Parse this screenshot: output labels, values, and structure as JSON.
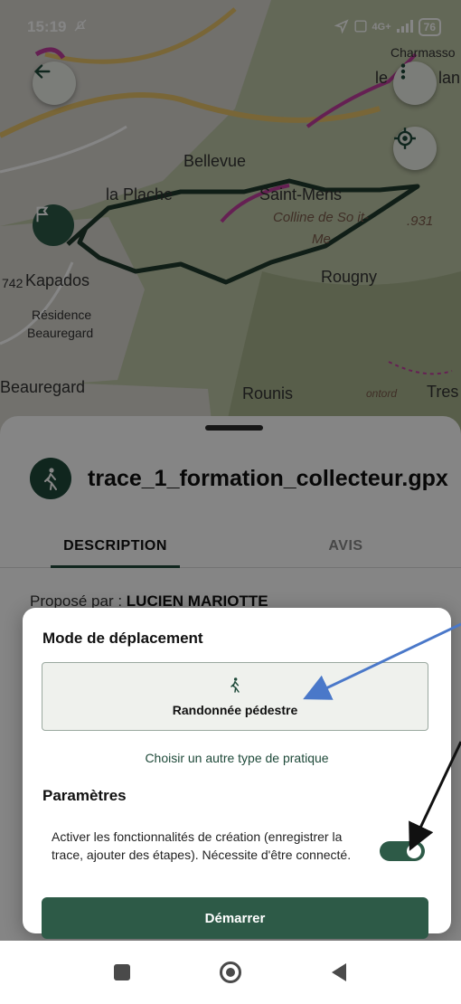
{
  "status_bar": {
    "time": "15:19",
    "network": "4G+",
    "battery": "76"
  },
  "map": {
    "labels": [
      "Charmasso",
      "le",
      "lan",
      "Bellevue",
      "la Plache",
      "Saint-Mens",
      "Colline de So it-",
      "Me",
      ".931",
      "742",
      "Kapados",
      "Rougny",
      "Résidence",
      "Beauregard",
      "Beauregard",
      "Rounis",
      "Tres",
      "ontord"
    ]
  },
  "sheet": {
    "title": "trace_1_formation_collecteur.gpx",
    "tabs": [
      "DESCRIPTION",
      "AVIS"
    ],
    "proposed_prefix": "Proposé par : ",
    "proposed_name": "LUCIEN MARIOTTE"
  },
  "dialog": {
    "title": "Mode de déplacement",
    "mode_label": "Randonnée pédestre",
    "other_link": "Choisir un autre type de pratique",
    "params_title": "Paramètres",
    "params_text": "Activer les fonctionnalités de création (enregistrer la trace, ajouter des étapes). Nécessite d'être connecté.",
    "toggle_on": true,
    "start_label": "Démarrer"
  },
  "colors": {
    "primary": "#2d5a47",
    "trace": "#1f3a2c",
    "pink_route": "#c23fa0",
    "arrow_blue": "#4a78c9",
    "arrow_black": "#111111"
  },
  "icons": {
    "back": "arrow-left-icon",
    "menu": "more-vertical-icon",
    "locate": "crosshair-icon",
    "hike": "hiker-icon"
  }
}
